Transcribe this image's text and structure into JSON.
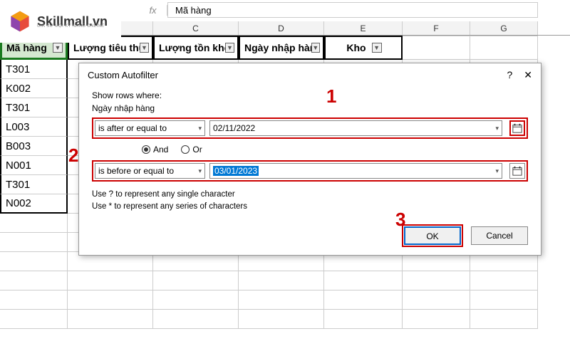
{
  "logo": {
    "brand": "Skillmall.vn",
    "tagline": "GIÁ SƯ MỌI KỸ NĂNG ONLINE"
  },
  "formula_bar": {
    "fx": "fx",
    "value": "Mã hàng"
  },
  "columns": {
    "a_width": 95,
    "b_width": 120,
    "c_width": 120,
    "d_width": 120,
    "e_width": 110,
    "f_width": 95,
    "g_width": 95,
    "labels": {
      "C": "C",
      "D": "D",
      "E": "E",
      "F": "F",
      "G": "G"
    }
  },
  "headers": [
    "Mã hàng",
    "Lượng tiêu thụ",
    "Lượng tồn kho",
    "Ngày nhập hàng",
    "Kho"
  ],
  "colA_data": [
    "T301",
    "K002",
    "T301",
    "L003",
    "B003",
    "N001",
    "T301",
    "N002"
  ],
  "dialog": {
    "title": "Custom Autofilter",
    "show_rows": "Show rows where:",
    "field_label": "Ngày nhập hàng",
    "criteria": [
      {
        "op": "is after or equal to",
        "value": "02/11/2022",
        "selected": false
      },
      {
        "op": "is before or equal to",
        "value": "03/01/2023",
        "selected": true
      }
    ],
    "logic": {
      "and": "And",
      "or": "Or",
      "selected": "and"
    },
    "hint1": "Use ? to represent any single character",
    "hint2": "Use * to represent any series of characters",
    "ok": "OK",
    "cancel": "Cancel",
    "help": "?",
    "close": "✕"
  },
  "annotations": {
    "a1": "1",
    "a2": "2",
    "a3": "3"
  }
}
